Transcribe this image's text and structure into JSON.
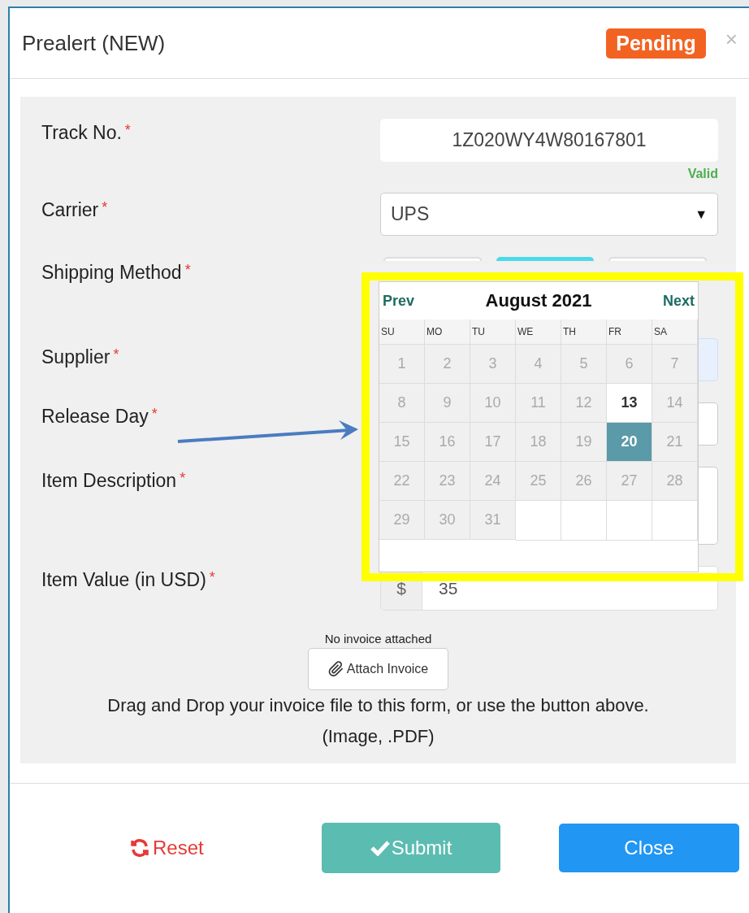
{
  "dialog": {
    "title": "Prealert (NEW)",
    "status": "Pending",
    "close": "×"
  },
  "form": {
    "track": {
      "label": "Track No.",
      "required": "*",
      "value": "1Z020WY4W80167801",
      "validation": "Valid"
    },
    "carrier": {
      "label": "Carrier",
      "required": "*",
      "value": "UPS",
      "caret": "▼"
    },
    "shipping_method": {
      "label": "Shipping Method",
      "required": "*",
      "options": [
        {
          "selected": false
        },
        {
          "selected": true
        },
        {
          "selected": false
        }
      ]
    },
    "supplier": {
      "label": "Supplier",
      "required": "*"
    },
    "release_day": {
      "label": "Release Day",
      "required": "*"
    },
    "item_description": {
      "label": "Item Description",
      "required": "*"
    },
    "item_value": {
      "label": "Item Value (in USD)",
      "required": "*",
      "prefix": "$",
      "value": "35"
    },
    "invoice": {
      "status": "No invoice attached",
      "button": "Attach Invoice",
      "hint": "Drag and Drop your invoice file to this form, or use the button above.",
      "formats": "(Image, .PDF)"
    }
  },
  "calendar": {
    "prev": "Prev",
    "title": "August 2021",
    "next": "Next",
    "weekdays": [
      "SU",
      "MO",
      "TU",
      "WE",
      "TH",
      "FR",
      "SA"
    ],
    "weeks": [
      [
        {
          "kind": "day",
          "label": "1",
          "disabled": true,
          "selected": false
        },
        {
          "kind": "day",
          "label": "2",
          "disabled": true,
          "selected": false
        },
        {
          "kind": "day",
          "label": "3",
          "disabled": true,
          "selected": false
        },
        {
          "kind": "day",
          "label": "4",
          "disabled": true,
          "selected": false
        },
        {
          "kind": "day",
          "label": "5",
          "disabled": true,
          "selected": false
        },
        {
          "kind": "day",
          "label": "6",
          "disabled": true,
          "selected": false
        },
        {
          "kind": "day",
          "label": "7",
          "disabled": true,
          "selected": false
        }
      ],
      [
        {
          "kind": "day",
          "label": "8",
          "disabled": true,
          "selected": false
        },
        {
          "kind": "day",
          "label": "9",
          "disabled": true,
          "selected": false
        },
        {
          "kind": "day",
          "label": "10",
          "disabled": true,
          "selected": false
        },
        {
          "kind": "day",
          "label": "11",
          "disabled": true,
          "selected": false
        },
        {
          "kind": "day",
          "label": "12",
          "disabled": true,
          "selected": false
        },
        {
          "kind": "day",
          "label": "13",
          "disabled": false,
          "selected": false
        },
        {
          "kind": "day",
          "label": "14",
          "disabled": true,
          "selected": false
        }
      ],
      [
        {
          "kind": "day",
          "label": "15",
          "disabled": true,
          "selected": false
        },
        {
          "kind": "day",
          "label": "16",
          "disabled": true,
          "selected": false
        },
        {
          "kind": "day",
          "label": "17",
          "disabled": true,
          "selected": false
        },
        {
          "kind": "day",
          "label": "18",
          "disabled": true,
          "selected": false
        },
        {
          "kind": "day",
          "label": "19",
          "disabled": true,
          "selected": false
        },
        {
          "kind": "day",
          "label": "20",
          "disabled": false,
          "selected": true
        },
        {
          "kind": "day",
          "label": "21",
          "disabled": true,
          "selected": false
        }
      ],
      [
        {
          "kind": "day",
          "label": "22",
          "disabled": true,
          "selected": false
        },
        {
          "kind": "day",
          "label": "23",
          "disabled": true,
          "selected": false
        },
        {
          "kind": "day",
          "label": "24",
          "disabled": true,
          "selected": false
        },
        {
          "kind": "day",
          "label": "25",
          "disabled": true,
          "selected": false
        },
        {
          "kind": "day",
          "label": "26",
          "disabled": true,
          "selected": false
        },
        {
          "kind": "day",
          "label": "27",
          "disabled": true,
          "selected": false
        },
        {
          "kind": "day",
          "label": "28",
          "disabled": true,
          "selected": false
        }
      ],
      [
        {
          "kind": "day",
          "label": "29",
          "disabled": true,
          "selected": false
        },
        {
          "kind": "day",
          "label": "30",
          "disabled": true,
          "selected": false
        },
        {
          "kind": "day",
          "label": "31",
          "disabled": true,
          "selected": false
        },
        {
          "kind": "blank"
        },
        {
          "kind": "blank"
        },
        {
          "kind": "blank"
        },
        {
          "kind": "blank"
        }
      ]
    ]
  },
  "annotation": {
    "arrow": true,
    "highlight": true
  },
  "footer": {
    "reset": "Reset",
    "submit": "Submit",
    "close": "Close"
  }
}
